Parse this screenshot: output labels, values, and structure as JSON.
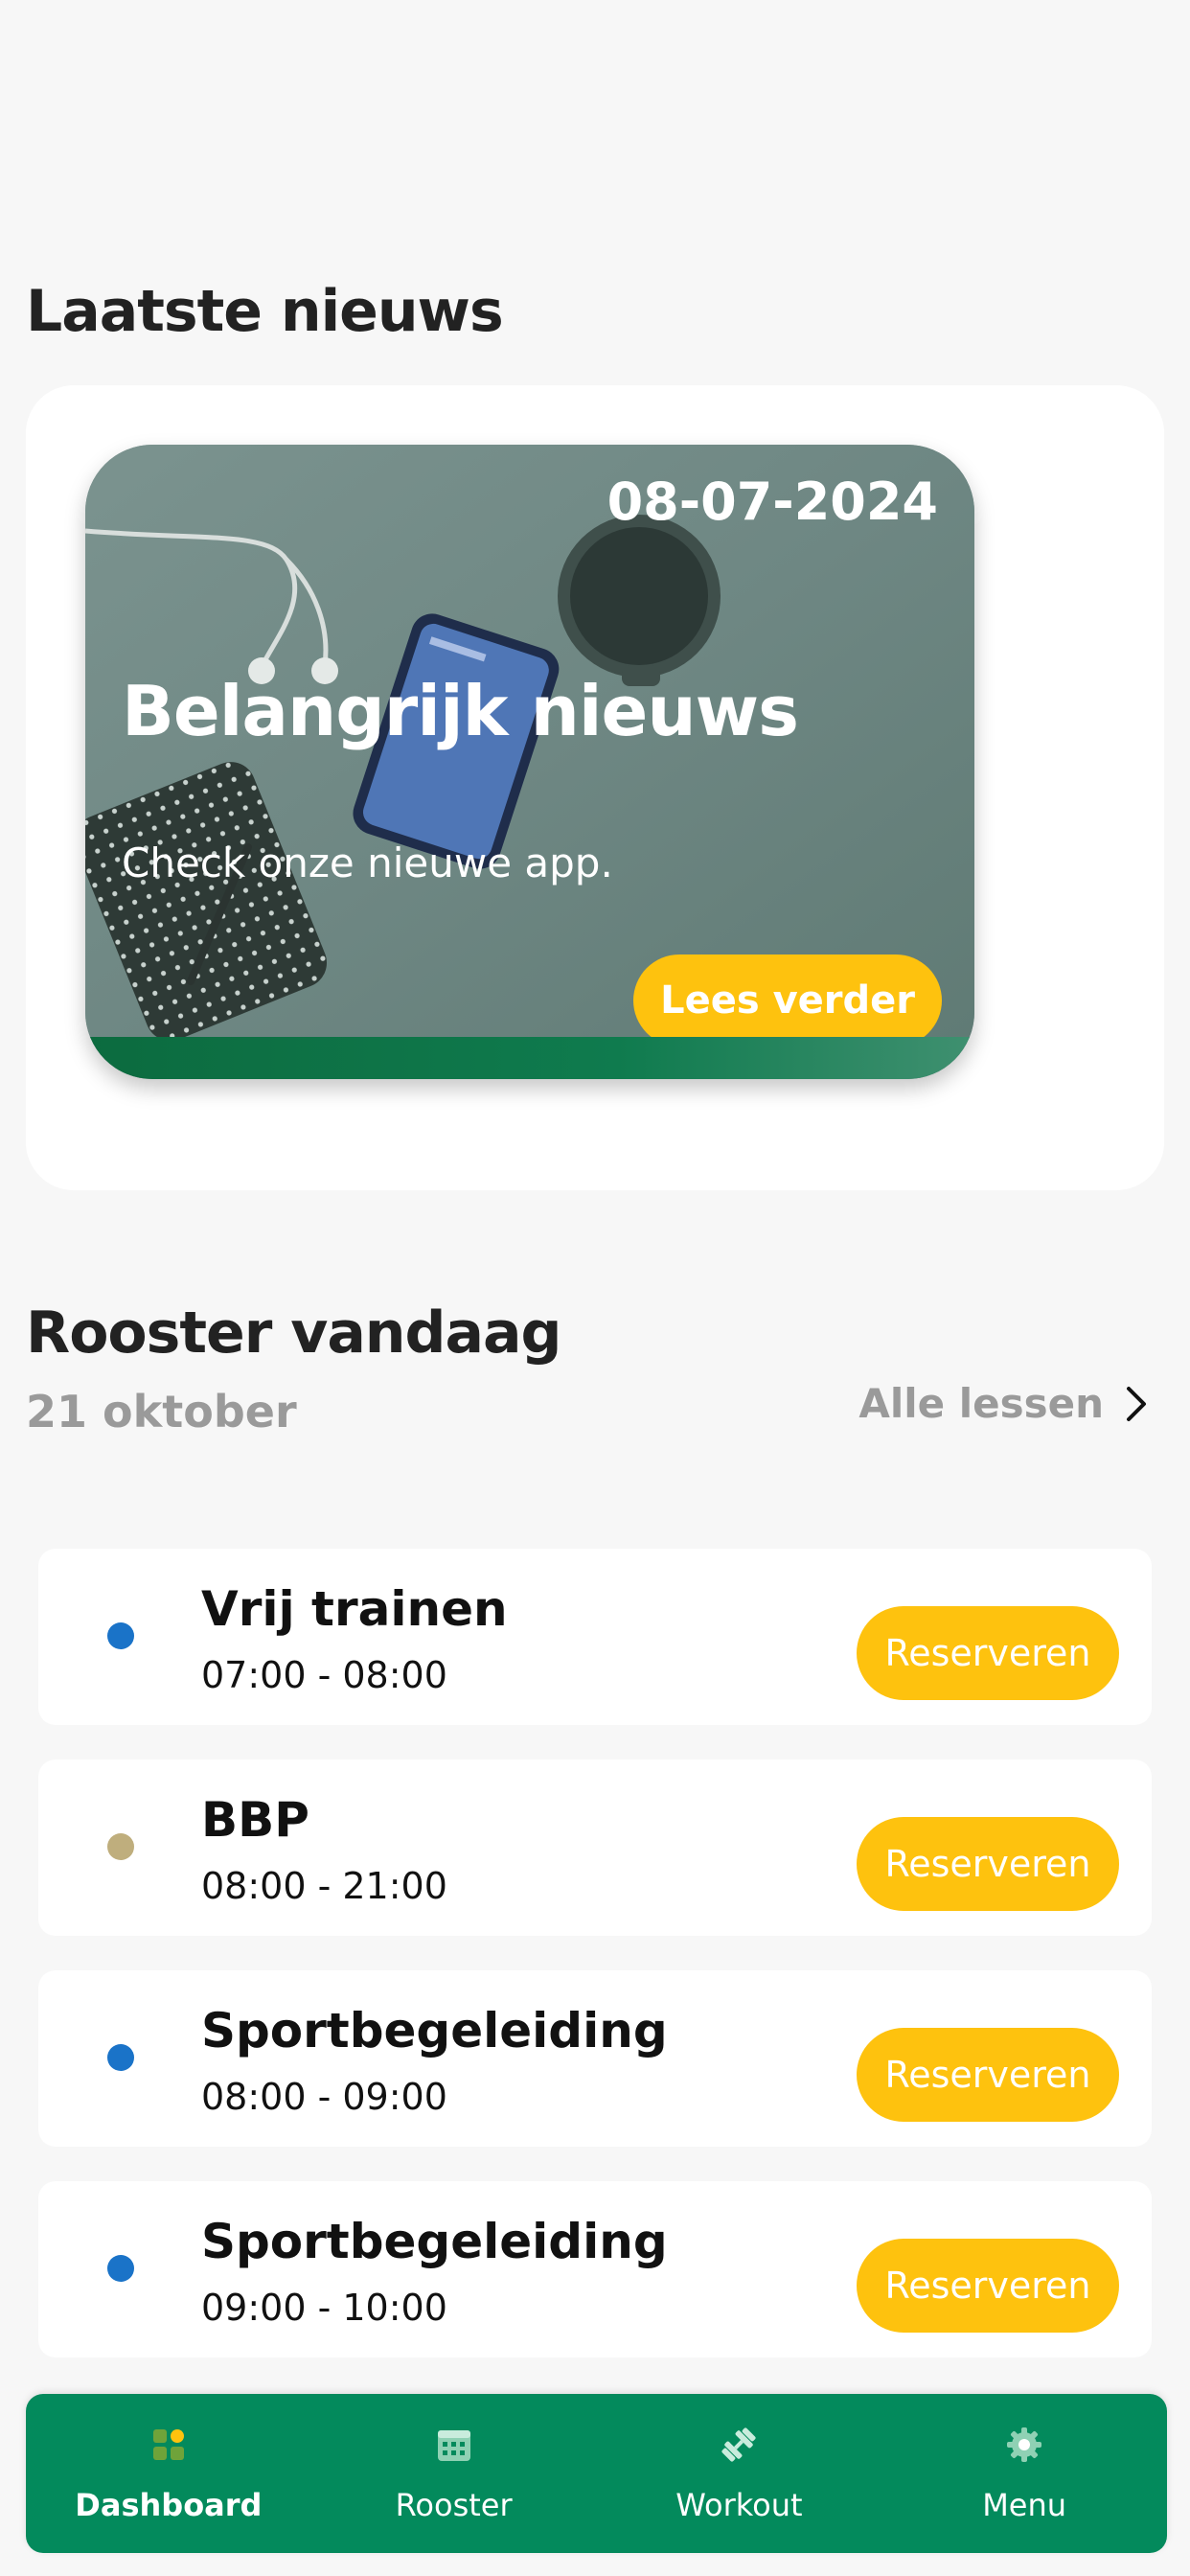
{
  "news": {
    "section_title": "Laatste nieuws",
    "card": {
      "date": "08-07-2024",
      "headline": "Belangrijk nieuws",
      "subtitle": "Check onze nieuwe app.",
      "button_label": "Lees verder"
    }
  },
  "schedule": {
    "section_title": "Rooster vandaag",
    "date": "21 oktober",
    "all_link_label": "Alle lessen",
    "items": [
      {
        "name": "Vrij trainen",
        "time": "07:00 - 08:00",
        "dot_color": "#1a73c8",
        "button_label": "Reserveren"
      },
      {
        "name": "BBP",
        "time": "08:00 - 21:00",
        "dot_color": "#bfae7d",
        "button_label": "Reserveren"
      },
      {
        "name": "Sportbegeleiding",
        "time": "08:00 - 09:00",
        "dot_color": "#1a73c8",
        "button_label": "Reserveren"
      },
      {
        "name": "Sportbegeleiding",
        "time": "09:00 - 10:00",
        "dot_color": "#1a73c8",
        "button_label": "Reserveren"
      }
    ]
  },
  "nav": {
    "items": [
      {
        "label": "Dashboard",
        "icon": "dashboard-icon",
        "active": true
      },
      {
        "label": "Rooster",
        "icon": "calendar-icon",
        "active": false
      },
      {
        "label": "Workout",
        "icon": "dumbbell-icon",
        "active": false
      },
      {
        "label": "Menu",
        "icon": "gear-icon",
        "active": false
      }
    ]
  },
  "colors": {
    "accent_yellow": "#fec20e",
    "brand_green": "#038a5c",
    "background": "#f7f7f7"
  }
}
